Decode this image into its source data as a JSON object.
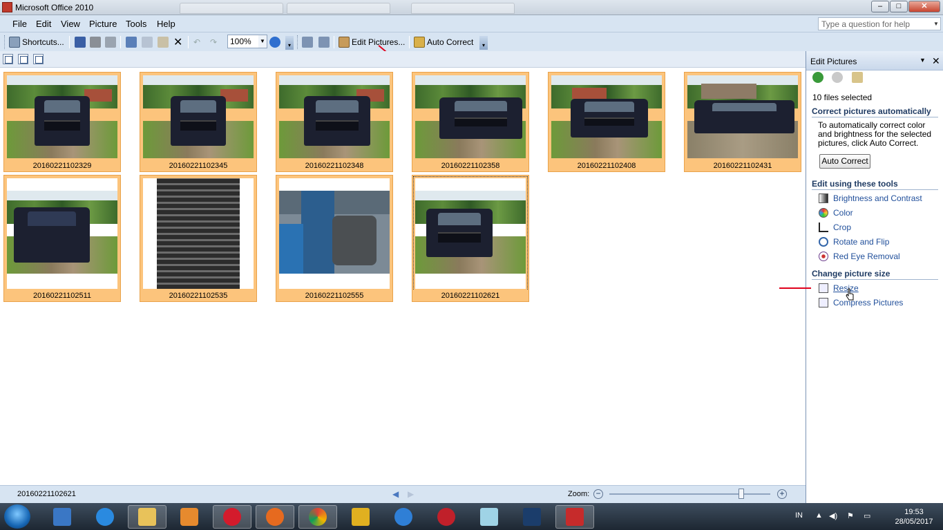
{
  "window": {
    "title": "Microsoft Office 2010",
    "controls": {
      "minimize": "–",
      "maximize": "□",
      "close": "✕"
    }
  },
  "menu": {
    "items": [
      "File",
      "Edit",
      "View",
      "Picture",
      "Tools",
      "Help"
    ],
    "help_placeholder": "Type a question for help"
  },
  "toolbar": {
    "shortcuts_label": "Shortcuts...",
    "zoom_value": "100%",
    "edit_pictures_label": "Edit Pictures...",
    "auto_correct_label": "Auto Correct"
  },
  "thumbnails": [
    {
      "filename": "20160221102329",
      "scene": "front"
    },
    {
      "filename": "20160221102345",
      "scene": "front"
    },
    {
      "filename": "20160221102348",
      "scene": "front"
    },
    {
      "filename": "20160221102358",
      "scene": "side"
    },
    {
      "filename": "20160221102408",
      "scene": "side"
    },
    {
      "filename": "20160221102431",
      "scene": "side"
    },
    {
      "filename": "20160221102511",
      "scene": "rear"
    },
    {
      "filename": "20160221102535",
      "scene": "bed"
    },
    {
      "filename": "20160221102555",
      "scene": "cab"
    },
    {
      "filename": "20160221102621",
      "scene": "front"
    }
  ],
  "task_pane": {
    "title": "Edit Pictures",
    "selection_count": "10 files selected",
    "section_auto": "Correct pictures automatically",
    "auto_description": "To automatically correct color and brightness for the selected pictures, click Auto Correct.",
    "auto_correct_button": "Auto Correct",
    "section_tools": "Edit using these tools",
    "tools": [
      "Brightness and Contrast",
      "Color",
      "Crop",
      "Rotate and Flip",
      "Red Eye Removal"
    ],
    "section_size": "Change picture size",
    "size_tools": [
      "Resize",
      "Compress Pictures"
    ]
  },
  "status": {
    "current_file": "20160221102621",
    "zoom_label": "Zoom:",
    "zoom_level": 0.82
  },
  "taskbar": {
    "language": "IN",
    "time": "19:53",
    "date": "28/05/2017"
  }
}
